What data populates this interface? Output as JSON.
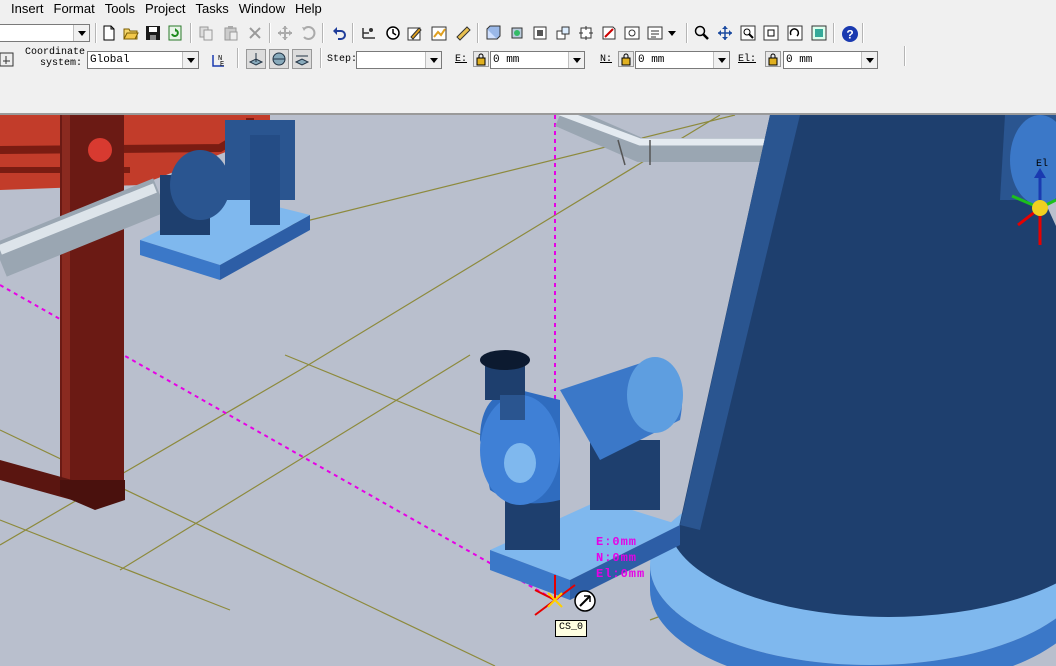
{
  "menubar": {
    "items": [
      {
        "label": "Insert"
      },
      {
        "label": "Format"
      },
      {
        "label": "Tools"
      },
      {
        "label": "Project"
      },
      {
        "label": "Tasks"
      },
      {
        "label": "Window"
      },
      {
        "label": "Help"
      }
    ]
  },
  "toolbar1": {
    "left_combo_value": "",
    "icons": [
      "new-file-icon",
      "open-folder-icon",
      "save-icon",
      "refresh-icon",
      "copy-icon",
      "paste-icon",
      "delete-icon",
      "move-icon",
      "rotate-icon",
      "undo-icon",
      "measure-icon",
      "clock-icon",
      "edit-icon",
      "chart-icon",
      "ruler-icon",
      "view-icon",
      "view2-icon",
      "view3-icon",
      "view4-icon",
      "view5-icon",
      "view6-icon",
      "view7-icon",
      "view8-icon",
      "dropdown-icon",
      "zoom-icon",
      "pan-icon",
      "zoom-area-icon",
      "fit-icon",
      "rotate-view-icon",
      "snapshot-icon",
      "help-icon"
    ]
  },
  "toolbar2": {
    "coordinate_label_line1": "Coordinate",
    "coordinate_label_line2": "system:",
    "coordinate_value": "Global",
    "step_label": "Step:",
    "step_value": "",
    "e_label": "E:",
    "e_value": "0 mm",
    "n_label": "N:",
    "n_value": "0 mm",
    "el_label": "El:",
    "el_value": "0 mm"
  },
  "viewport": {
    "readout_e": "E:0mm",
    "readout_n": "N:0mm",
    "readout_el": "El:0mm",
    "cs_tag": "CS_0",
    "axis_label": "El",
    "colors": {
      "background": "#b9bfcd",
      "equipment": "#1e3f6e",
      "equipment_light": "#7fb8ee",
      "pipe": "#c8d2dc",
      "steel": "#6b1a14",
      "dashed": "#e600e6",
      "grid": "#8d8a3c"
    }
  }
}
